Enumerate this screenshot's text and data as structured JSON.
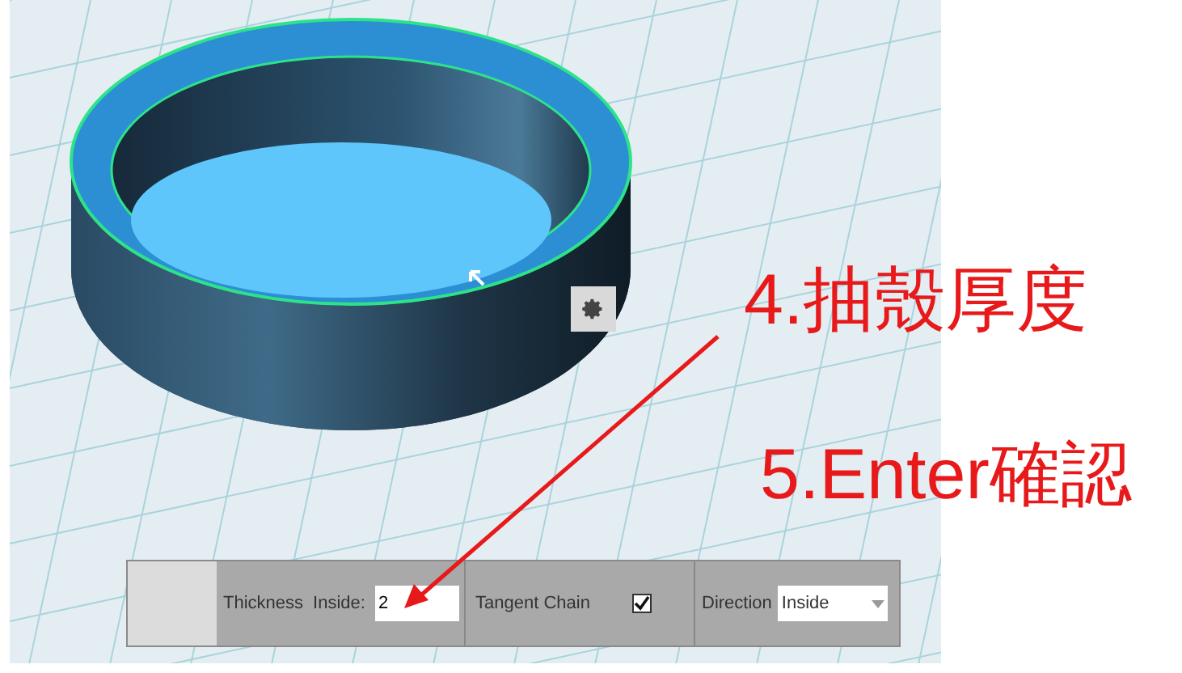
{
  "annotations": [
    {
      "text": "4.抽殼厚度"
    },
    {
      "text": "5.Enter確認"
    }
  ],
  "toolbar": {
    "thickness_label": "Thickness",
    "inside_label": "Inside:",
    "thickness_value": "2",
    "tangent_chain": {
      "label": "Tangent Chain",
      "checked": true
    },
    "direction": {
      "label": "Direction",
      "value": "Inside"
    }
  }
}
